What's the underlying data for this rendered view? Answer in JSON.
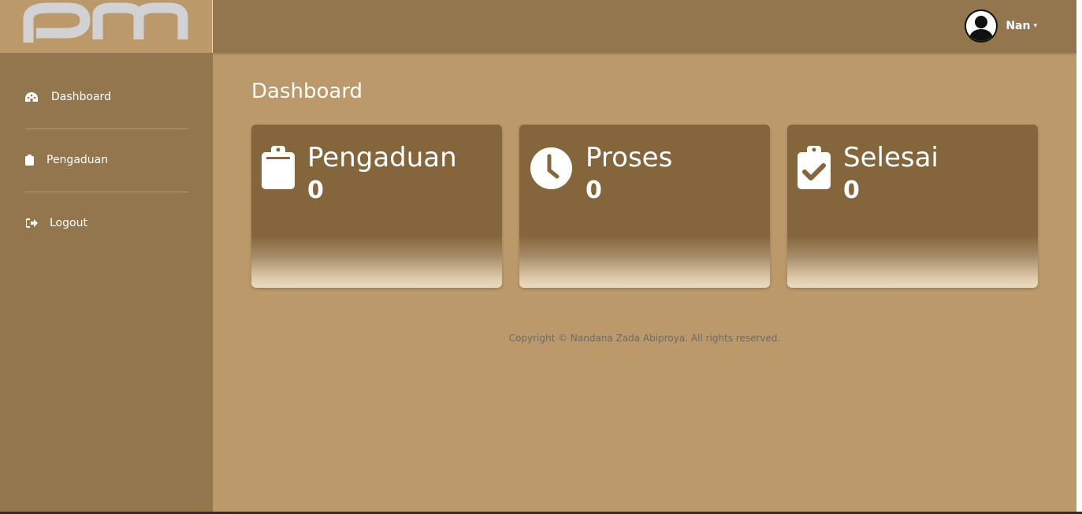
{
  "header": {
    "user_name": "Nan",
    "colors": {
      "topbar": "#93754E",
      "brand_bg": "#BB996A"
    }
  },
  "sidebar": {
    "items": [
      {
        "label": "Dashboard",
        "icon": "gauge-icon"
      },
      {
        "label": "Pengaduan",
        "icon": "clipboard-icon"
      },
      {
        "label": "Logout",
        "icon": "sign-out-icon"
      }
    ]
  },
  "main": {
    "title": "Dashboard",
    "cards": [
      {
        "label": "Pengaduan",
        "count": "0",
        "icon": "clipboard-icon"
      },
      {
        "label": "Proses",
        "count": "0",
        "icon": "clock-icon"
      },
      {
        "label": "Selesai",
        "count": "0",
        "icon": "clipboard-check-icon"
      }
    ]
  },
  "footer": {
    "text": "Copyright © Nandana Zada Abiproya. All rights reserved."
  }
}
